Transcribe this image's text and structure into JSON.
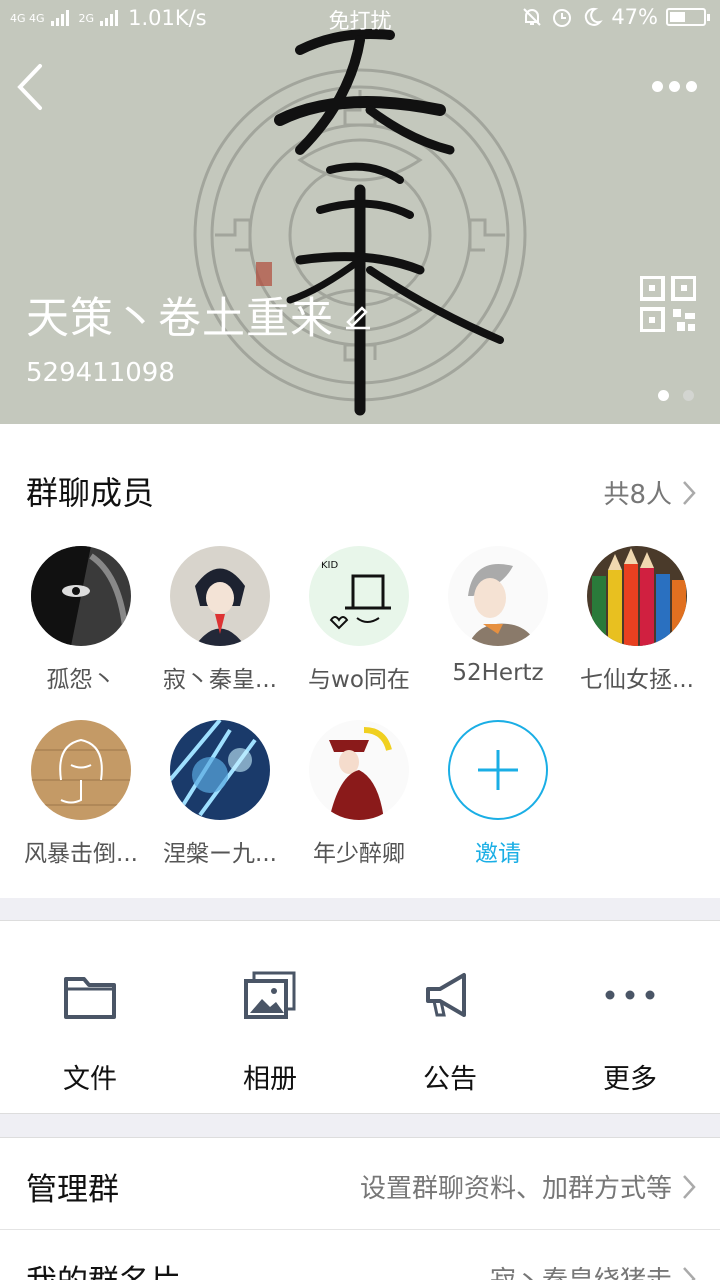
{
  "status_bar": {
    "signal_1": "4G 4G",
    "signal_2": "2G",
    "net_speed": "1.01K/s",
    "mode": "免打扰",
    "battery_percent": "47%",
    "battery_level": 0.47
  },
  "header": {
    "group_name": "天策丶卷土重来",
    "group_id": "529411098",
    "page_count": 2,
    "active_page": 1
  },
  "members": {
    "title": "群聊成员",
    "count_label": "共8人",
    "items": [
      {
        "name": "孤怨丶"
      },
      {
        "name": "寂丶秦皇..."
      },
      {
        "name": "与wo同在"
      },
      {
        "name": "52Hertz"
      },
      {
        "name": "七仙女拯..."
      },
      {
        "name": "风暴击倒..."
      },
      {
        "name": "涅槃ー九..."
      },
      {
        "name": "年少醉卿"
      }
    ],
    "invite_label": "邀请"
  },
  "actions": [
    {
      "label": "文件",
      "icon": "folder-icon"
    },
    {
      "label": "相册",
      "icon": "album-icon"
    },
    {
      "label": "公告",
      "icon": "megaphone-icon"
    },
    {
      "label": "更多",
      "icon": "more-icon"
    }
  ],
  "settings": {
    "manage_title": "管理群",
    "manage_value": "设置群聊资料、加群方式等",
    "card_title": "我的群名片",
    "card_value": "寂丶秦皇绕猪走"
  },
  "colors": {
    "accent": "#1aaee5",
    "header_bg": "#c4c8bd"
  }
}
